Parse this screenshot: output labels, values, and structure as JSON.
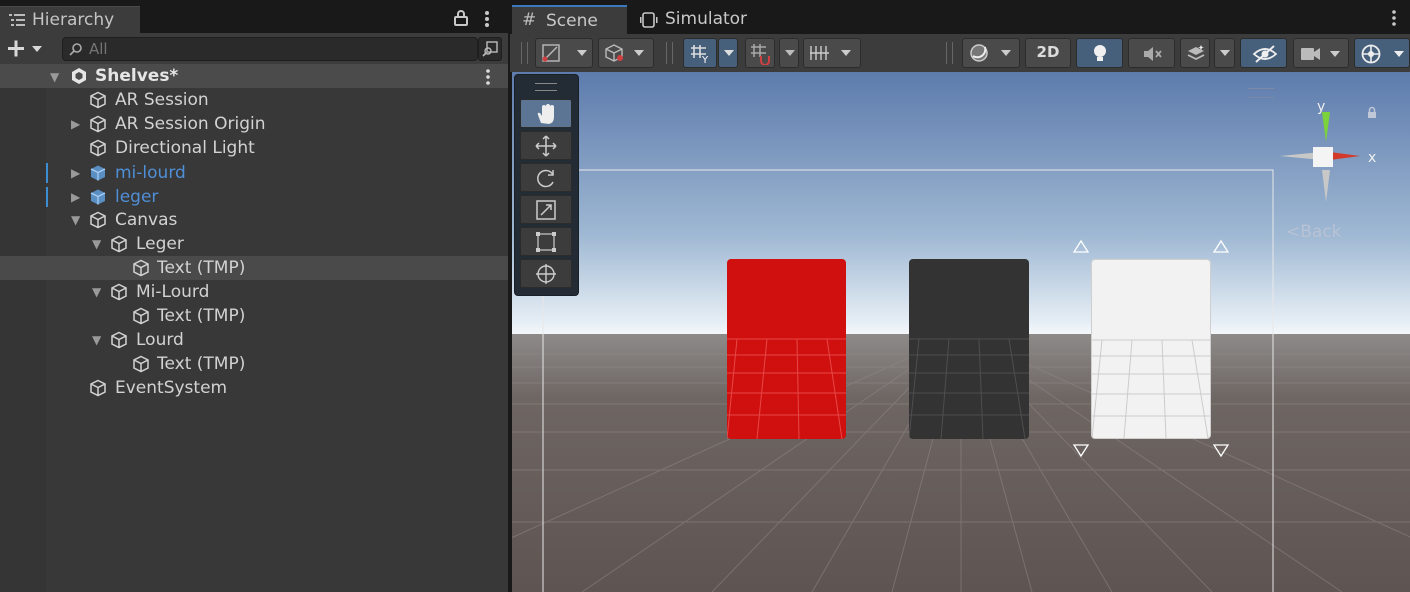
{
  "hierarchy": {
    "tab_title": "Hierarchy",
    "search_placeholder": "All",
    "scene_name": "Shelves*",
    "items": [
      {
        "label": "AR Session"
      },
      {
        "label": "AR Session Origin"
      },
      {
        "label": "Directional Light"
      },
      {
        "label": "mi-lourd"
      },
      {
        "label": "leger"
      },
      {
        "label": "Canvas"
      },
      {
        "label": "Leger"
      },
      {
        "label": "Text (TMP)"
      },
      {
        "label": "Mi-Lourd"
      },
      {
        "label": "Text (TMP)"
      },
      {
        "label": "Lourd"
      },
      {
        "label": "Text (TMP)"
      },
      {
        "label": "EventSystem"
      }
    ]
  },
  "scene": {
    "tabs": [
      {
        "label": "Scene"
      },
      {
        "label": "Simulator"
      }
    ],
    "toggle_2d": "2D",
    "gizmo": {
      "y": "y",
      "x": "x",
      "back": "Back"
    }
  },
  "colors": {
    "selected_accent": "#46607c",
    "prefab_blue": "#4f8fd6",
    "card_red": "#d0100f",
    "card_dark": "#333333",
    "card_white": "#f2f2f2"
  }
}
